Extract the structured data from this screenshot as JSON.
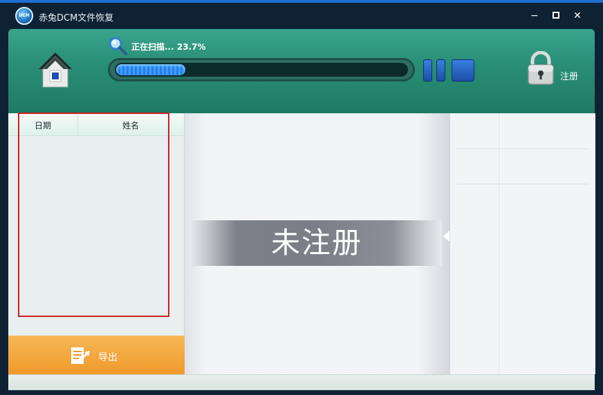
{
  "window": {
    "title": "赤兔DCM文件恢复",
    "logo_text": "DCM"
  },
  "titlebar": {
    "minimize": "−",
    "close": "✕"
  },
  "scan": {
    "status_text": "正在扫描... 23.7%",
    "progress_percent": 23.7
  },
  "header": {
    "register_label": "注册"
  },
  "table": {
    "columns": [
      "日期",
      "姓名"
    ]
  },
  "export": {
    "label": "导出"
  },
  "center": {
    "unregistered_text": "未注册"
  },
  "icons": {
    "home": "home-icon",
    "search": "magnifier-icon",
    "pause": "pause-icon",
    "stop": "stop-icon",
    "lock": "lock-icon",
    "export": "export-icon"
  },
  "colors": {
    "header_green": "#2a8f77",
    "progress_blue": "#2b7de6",
    "export_orange": "#ef9a2a",
    "highlight_red": "#cc1f1f"
  }
}
